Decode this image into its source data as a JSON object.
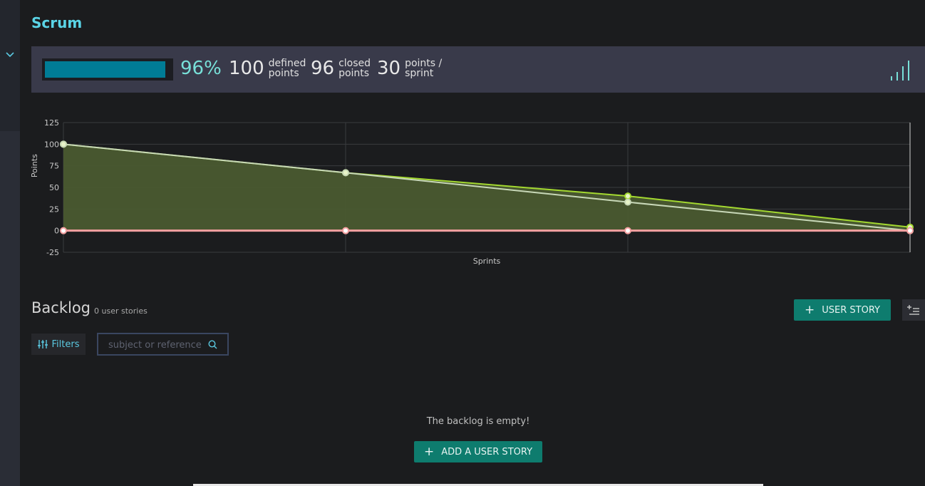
{
  "page": {
    "title": "Scrum"
  },
  "summary": {
    "progress_percent": 96,
    "percent_label": "96%",
    "defined_points": "100",
    "defined_label_1": "defined",
    "defined_label_2": "points",
    "closed_points": "96",
    "closed_label_1": "closed",
    "closed_label_2": "points",
    "points_per_sprint": "30",
    "pps_label_1": "points /",
    "pps_label_2": "sprint",
    "accent_color": "#78e0d8",
    "progress_color": "#007c96"
  },
  "chart_data": {
    "type": "area",
    "xlabel": "Sprints",
    "ylabel": "Points",
    "ylim": [
      -25,
      125
    ],
    "yticks": [
      "125",
      "100",
      "75",
      "50",
      "25",
      "0",
      "-25"
    ],
    "x": [
      0,
      1,
      2,
      3
    ],
    "grid": true,
    "series": [
      {
        "values": [
          100,
          67,
          40,
          4
        ],
        "color": "#a4d930",
        "fill": "#4a5a30"
      },
      {
        "values": [
          100,
          67,
          33,
          0
        ],
        "color": "#c8d8b8"
      },
      {
        "values": [
          0,
          0,
          0,
          0
        ],
        "color": "#f4a0a0"
      }
    ]
  },
  "backlog": {
    "title": "Backlog",
    "count": "0 user stories",
    "add_button": "USER STORY",
    "filters_label": "Filters",
    "search_placeholder": "subject or reference",
    "empty_message": "The backlog is empty!",
    "add_story_button": "ADD A USER STORY",
    "button_color": "#0e7c6e"
  }
}
